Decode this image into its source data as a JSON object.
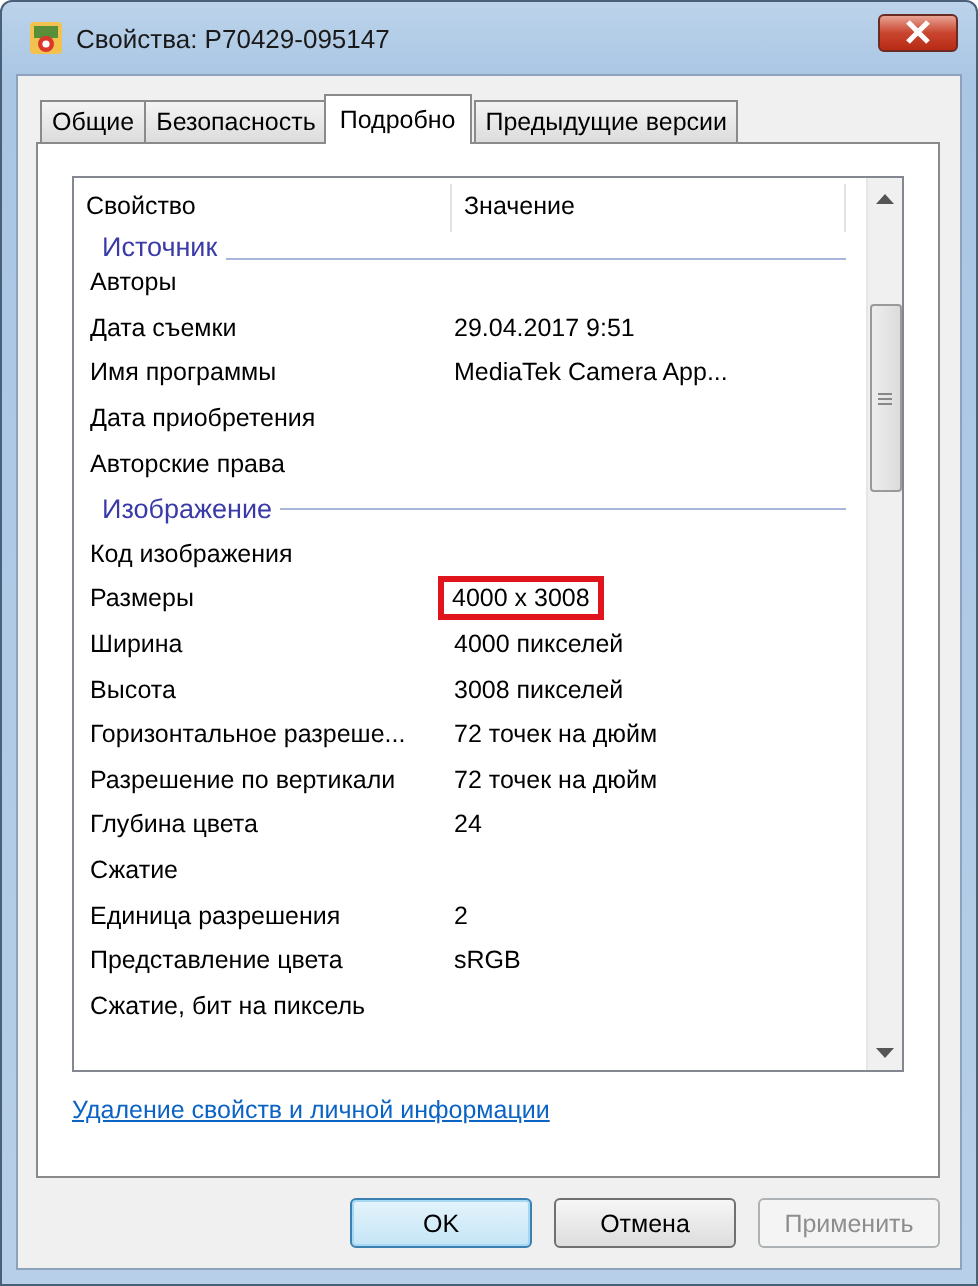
{
  "window": {
    "title": "Свойства: P70429-095147"
  },
  "tabs": [
    {
      "label": "Общие",
      "selected": false
    },
    {
      "label": "Безопасность",
      "selected": false
    },
    {
      "label": "Подробно",
      "selected": true
    },
    {
      "label": "Предыдущие версии",
      "selected": false
    }
  ],
  "table": {
    "columns": [
      "Свойство",
      "Значение"
    ],
    "rows": [
      {
        "kind": "group",
        "label": "Источник"
      },
      {
        "kind": "row",
        "property": "Авторы"
      },
      {
        "kind": "row",
        "property": "Дата съемки",
        "value": "29.04.2017 9:51"
      },
      {
        "kind": "row",
        "property": "Имя программы",
        "value": "MediaTek Camera App..."
      },
      {
        "kind": "row",
        "property": "Дата приобретения"
      },
      {
        "kind": "row",
        "property": "Авторские права"
      },
      {
        "kind": "group",
        "label": "Изображение"
      },
      {
        "kind": "row",
        "property": "Код изображения"
      },
      {
        "kind": "row",
        "property": "Размеры",
        "value": "4000 x 3008",
        "highlighted": true
      },
      {
        "kind": "row",
        "property": "Ширина",
        "value": "4000 пикселей"
      },
      {
        "kind": "row",
        "property": "Высота",
        "value": "3008 пикселей"
      },
      {
        "kind": "row",
        "property": "Горизонтальное разреше...",
        "value": "72 точек на дюйм"
      },
      {
        "kind": "row",
        "property": "Разрешение по вертикали",
        "value": "72 точек на дюйм"
      },
      {
        "kind": "row",
        "property": "Глубина цвета",
        "value": "24"
      },
      {
        "kind": "row",
        "property": "Сжатие"
      },
      {
        "kind": "row",
        "property": "Единица разрешения",
        "value": "2"
      },
      {
        "kind": "row",
        "property": "Представление цвета",
        "value": "sRGB"
      },
      {
        "kind": "row",
        "property": "Сжатие, бит на пиксель"
      }
    ]
  },
  "link": "Удаление свойств и личной информации",
  "buttons": [
    {
      "label": "OK",
      "kind": "default",
      "disabled": false
    },
    {
      "label": "Отмена",
      "kind": "normal",
      "disabled": false
    },
    {
      "label": "Применить",
      "kind": "normal",
      "disabled": true
    }
  ]
}
